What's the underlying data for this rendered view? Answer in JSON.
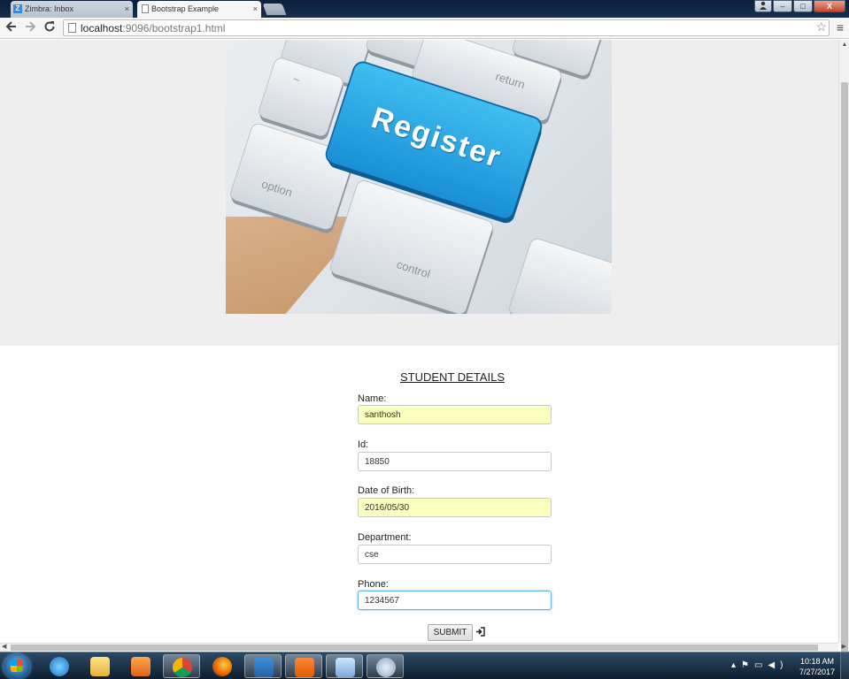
{
  "browser": {
    "tabs": [
      {
        "label": "Zimbra: Inbox",
        "close": "×",
        "icon": "Z",
        "active": false
      },
      {
        "label": "Bootstrap Example",
        "close": "×",
        "active": true
      }
    ],
    "url_host": "localhost",
    "url_rest": ":9096/bootstrap1.html",
    "window_buttons": {
      "minimize": "–",
      "maximize": "□",
      "close": "X"
    }
  },
  "page": {
    "banner_image_text": {
      "register_key": "Register",
      "key_labels": [
        "return",
        "option",
        "control",
        "~"
      ]
    },
    "form": {
      "title": "STUDENT DETAILS",
      "fields": [
        {
          "label": "Name:",
          "value": "santhosh",
          "state": "autofill"
        },
        {
          "label": "Id:",
          "value": "18850",
          "state": "normal"
        },
        {
          "label": "Date of Birth:",
          "value": "2016/05/30",
          "state": "autofill"
        },
        {
          "label": "Department:",
          "value": "cse",
          "state": "normal"
        },
        {
          "label": "Phone:",
          "value": "1234567",
          "state": "focused"
        }
      ],
      "submit_label": "SUBMIT",
      "submit_icon": "log-in-icon"
    }
  },
  "taskbar": {
    "apps": [
      "internet-explorer",
      "file-explorer",
      "media-player",
      "chrome",
      "firefox",
      "visual-studio",
      "xampp",
      "paint",
      "other"
    ],
    "clock_time": "10:18 AM",
    "clock_date": "7/27/2017"
  },
  "colors": {
    "jumbotron": "#eeeeee",
    "autofill": "#faffbd",
    "register_key": "#1a8fd6",
    "focus_border": "#66afe9"
  }
}
